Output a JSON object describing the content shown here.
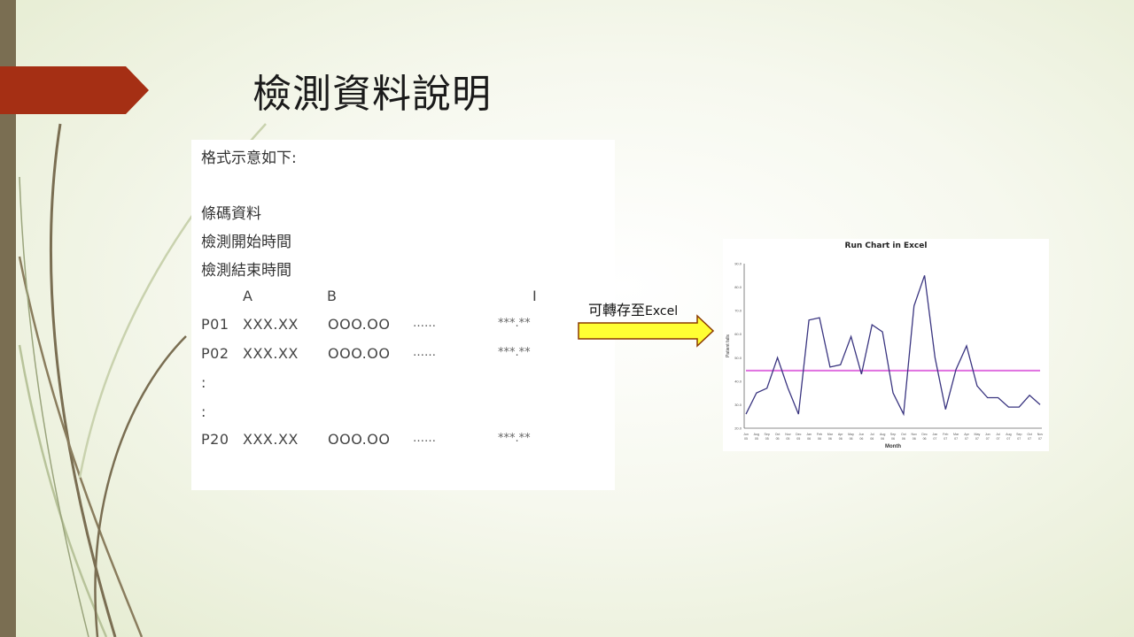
{
  "slide": {
    "title": "檢測資料說明"
  },
  "content": {
    "intro": "格式示意如下:",
    "fields": [
      "條碼資料",
      "檢測開始時間",
      "檢測結束時間"
    ],
    "columns": [
      "A",
      "B",
      "I"
    ],
    "rows": [
      {
        "id": "P01",
        "a": "XXX.XX",
        "b": "OOO.OO",
        "dots": "……",
        "i": "***.**"
      },
      {
        "id": "P02",
        "a": "XXX.XX",
        "b": "OOO.OO",
        "dots": "……",
        "i": "***.**"
      },
      {
        "id": "P20",
        "a": "XXX.XX",
        "b": "OOO.OO",
        "dots": "……",
        "i": "***.**"
      }
    ],
    "ellipsis_rows": [
      ":",
      ":"
    ]
  },
  "callout": {
    "text": "可轉存至",
    "target": "Excel"
  },
  "colors": {
    "accent_flag": "#a52f14",
    "left_bar": "#7a6e52",
    "arrow_fill": "#ffff33",
    "arrow_stroke": "#8b3a00",
    "series_line": "#3a3580",
    "mean_line": "#e070e0"
  },
  "chart_data": {
    "type": "line",
    "title": "Run Chart in Excel",
    "xlabel": "Month",
    "ylabel": "Patient falls",
    "ylim": [
      20,
      90
    ],
    "ticks": [
      20,
      30,
      40,
      50,
      60,
      70,
      80,
      90
    ],
    "categories": [
      "Jun 05",
      "Aug 05",
      "Sep 05",
      "Oct 05",
      "Nov 05",
      "Dec 05",
      "Jan 06",
      "Feb 06",
      "Mar 06",
      "Apr 06",
      "May 06",
      "Jun 06",
      "Jul 06",
      "Aug 06",
      "Sep 06",
      "Oct 06",
      "Nov 06",
      "Dec 06",
      "Jan 07",
      "Feb 07",
      "Mar 07",
      "Apr 07",
      "May 07",
      "Jun 07",
      "Jul 07",
      "Aug 07",
      "Sep 07",
      "Oct 07",
      "Nov 07"
    ],
    "values": [
      26,
      35,
      37,
      50,
      37,
      26,
      66,
      67,
      46,
      47,
      59,
      43,
      64,
      61,
      35,
      26,
      72,
      85,
      50,
      28,
      45,
      55,
      38,
      33,
      33,
      29,
      29,
      34,
      30
    ],
    "mean": 44.5
  }
}
